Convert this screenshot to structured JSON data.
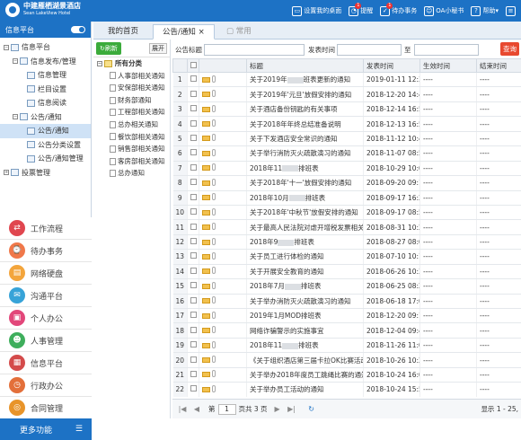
{
  "brand": {
    "name_cn": "中建雁栖湖景酒店",
    "name_en": "Sean LakeView Hotel"
  },
  "topbar": {
    "items": [
      {
        "label": "设置我的桌面",
        "icon": "desktop-icon",
        "badge": ""
      },
      {
        "label": "提醒",
        "icon": "bell-icon",
        "badge": "1"
      },
      {
        "label": "待办事务",
        "icon": "todo-icon",
        "badge": "1"
      },
      {
        "label": "OA小秘书",
        "icon": "user-icon",
        "badge": ""
      },
      {
        "label": "帮助",
        "icon": "help-icon",
        "badge": ""
      },
      {
        "label": "",
        "icon": "menu-icon",
        "badge": ""
      }
    ]
  },
  "sidebar": {
    "title": "信息平台",
    "tree": [
      "信息平台",
      "信息发布/管理",
      "信息管理",
      "栏目设置",
      "信息阅读",
      "公告/通知",
      "公告/通知",
      "公告分类设置",
      "公告/通知管理",
      "投票管理"
    ],
    "modules": [
      {
        "label": "工作流程",
        "color": "#e0464f"
      },
      {
        "label": "待办事务",
        "color": "#f0784a"
      },
      {
        "label": "网络硬盘",
        "color": "#f3a53c"
      },
      {
        "label": "沟通平台",
        "color": "#37a3d8"
      },
      {
        "label": "个人办公",
        "color": "#e2477a"
      },
      {
        "label": "人事管理",
        "color": "#3eae5c"
      },
      {
        "label": "信息平台",
        "color": "#d44b4b"
      },
      {
        "label": "行政办公",
        "color": "#e36f3a"
      },
      {
        "label": "合同管理",
        "color": "#e8942a"
      }
    ],
    "more_label": "更多功能"
  },
  "tabs": [
    "我的首页",
    "公告/通知",
    "常用"
  ],
  "subtree": {
    "refresh": "刷新",
    "expand": "展开",
    "root": "所有分类",
    "items": [
      "人事部相关通知",
      "安保部相关通知",
      "财务部通知",
      "工程部相关通知",
      "总办相关通知",
      "餐饮部相关通知",
      "销售部相关通知",
      "客房部相关通知",
      "总办通知"
    ]
  },
  "search": {
    "title_label": "公告标题",
    "time_label": "发表时间",
    "to_label": "至",
    "button": "查询"
  },
  "grid": {
    "headers": [
      "",
      "",
      "",
      "标题",
      "发表时间",
      "生效时间",
      "结束时间"
    ],
    "rows": [
      {
        "n": "1",
        "t": "关于2019年",
        "b": true,
        "t2": "班表更新的通知",
        "d": "2019-01-11 12:33",
        "e": "----",
        "f": "----",
        "env": true
      },
      {
        "n": "2",
        "t": "关于2019年'元旦'放假安排的通知",
        "b": false,
        "t2": "",
        "d": "2018-12-20 14:40",
        "e": "----",
        "f": "----",
        "env": true
      },
      {
        "n": "3",
        "t": "关于酒店备份钥匙的有关事项",
        "b": false,
        "t2": "",
        "d": "2018-12-14 16:50",
        "e": "----",
        "f": "----",
        "env": true
      },
      {
        "n": "4",
        "t": "关于2018年年终总结准备说明",
        "b": false,
        "t2": "",
        "d": "2018-12-13 16:52",
        "e": "----",
        "f": "----",
        "env": true
      },
      {
        "n": "5",
        "t": "关于下发酒店安全常识的通知",
        "b": false,
        "t2": "",
        "d": "2018-11-12 10:41",
        "e": "----",
        "f": "----",
        "env": true
      },
      {
        "n": "6",
        "t": "关于举行消防灭火疏散演习的通知",
        "b": false,
        "t2": "",
        "d": "2018-11-07 08:55",
        "e": "----",
        "f": "----",
        "env": true
      },
      {
        "n": "7",
        "t": "2018年11",
        "b": true,
        "t2": "排班表",
        "d": "2018-10-29 10:08",
        "e": "----",
        "f": "----",
        "env": true
      },
      {
        "n": "8",
        "t": "关于2018年'十一'放假安排的通知",
        "b": false,
        "t2": "",
        "d": "2018-09-20 09:13",
        "e": "----",
        "f": "----",
        "env": true
      },
      {
        "n": "9",
        "t": "2018年10月",
        "b": true,
        "t2": "排班表",
        "d": "2018-09-17 16:27",
        "e": "----",
        "f": "----",
        "env": true
      },
      {
        "n": "10",
        "t": "关于2018年'中秋节'放假安排的通知",
        "b": false,
        "t2": "",
        "d": "2018-09-17 08:54",
        "e": "----",
        "f": "----",
        "env": true
      },
      {
        "n": "11",
        "t": "关于最高人民法院对虐开增税发票相关...",
        "b": false,
        "t2": "",
        "d": "2018-08-31 10:26",
        "e": "----",
        "f": "----",
        "env": true
      },
      {
        "n": "12",
        "t": "2018年9",
        "b": true,
        "t2": "排班表",
        "d": "2018-08-27 08:09",
        "e": "----",
        "f": "----",
        "env": true
      },
      {
        "n": "13",
        "t": "关于员工进行体检的通知",
        "b": false,
        "t2": "",
        "d": "2018-07-10 10:12",
        "e": "----",
        "f": "----",
        "env": true
      },
      {
        "n": "14",
        "t": "关于开展安全教育的通知",
        "b": false,
        "t2": "",
        "d": "2018-06-26 10:34",
        "e": "----",
        "f": "----",
        "env": true
      },
      {
        "n": "15",
        "t": "2018年7月",
        "b": true,
        "t2": "排班表",
        "d": "2018-06-25 08:27",
        "e": "----",
        "f": "----",
        "env": true
      },
      {
        "n": "16",
        "t": "关于举办消防灭火疏散演习的通知",
        "b": false,
        "t2": "",
        "d": "2018-06-18 17:06",
        "e": "----",
        "f": "----",
        "env": true
      },
      {
        "n": "17",
        "t": "2019年1月MOD排班表",
        "b": false,
        "t2": "",
        "d": "2018-12-20 09:14",
        "e": "----",
        "f": "----",
        "env": true
      },
      {
        "n": "18",
        "t": "网络诈骗警示的实施事宜",
        "b": false,
        "t2": "",
        "d": "2018-12-04 09:44",
        "e": "----",
        "f": "----",
        "env": true
      },
      {
        "n": "19",
        "t": "2018年11",
        "b": true,
        "t2": "排班表",
        "d": "2018-11-26 11:00",
        "e": "----",
        "f": "----",
        "env": true
      },
      {
        "n": "20",
        "t": "《关于组织酒店第三届卡拉OK比赛活动...",
        "b": false,
        "t2": "",
        "d": "2018-10-26 10:27",
        "e": "----",
        "f": "----",
        "env": true
      },
      {
        "n": "21",
        "t": "关于举办2018年度员工跳绳比赛的通知",
        "b": false,
        "t2": "",
        "d": "2018-10-24 16:03",
        "e": "----",
        "f": "----",
        "env": true
      },
      {
        "n": "22",
        "t": "关于举办员工活动的通知",
        "b": false,
        "t2": "",
        "d": "2018-10-24 15:59",
        "e": "----",
        "f": "----",
        "env": true
      }
    ]
  },
  "pager": {
    "page_label": "第",
    "page": "1",
    "total_label": "页共 3 页",
    "status": "显示 1 - 25,"
  }
}
